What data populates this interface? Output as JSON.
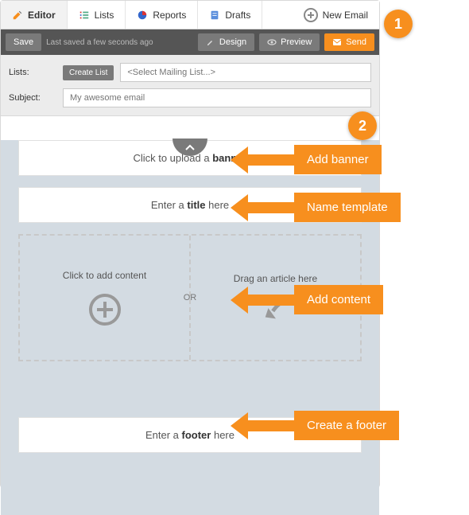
{
  "tabs": {
    "editor": "Editor",
    "lists": "Lists",
    "reports": "Reports",
    "drafts": "Drafts",
    "new_email": "New Email"
  },
  "toolbar": {
    "save": "Save",
    "saved_note": "Last saved a few seconds ago",
    "design": "Design",
    "preview": "Preview",
    "send": "Send"
  },
  "form": {
    "lists_label": "Lists:",
    "create_list": "Create List",
    "lists_placeholder": "<Select Mailing List...>",
    "subject_label": "Subject:",
    "subject_placeholder": "My awesome email"
  },
  "canvas": {
    "banner_pre": "Click to upload a ",
    "banner_bold": "banner",
    "title_pre": "Enter a ",
    "title_bold": "title",
    "title_post": " here",
    "add_content": "Click to add content",
    "or": "OR",
    "drag_pre": "Drag an ",
    "drag_bold": "article",
    "drag_post": " here",
    "footer_pre": "Enter a ",
    "footer_bold": "footer",
    "footer_post": " here"
  },
  "annotations": {
    "badge1": "1",
    "badge2": "2",
    "add_banner": "Add banner",
    "name_template": "Name template",
    "add_content": "Add content",
    "create_footer": "Create a footer"
  },
  "colors": {
    "accent": "#f78f1e",
    "toolbar": "#555555",
    "canvas_bg": "#d3dbe2"
  }
}
